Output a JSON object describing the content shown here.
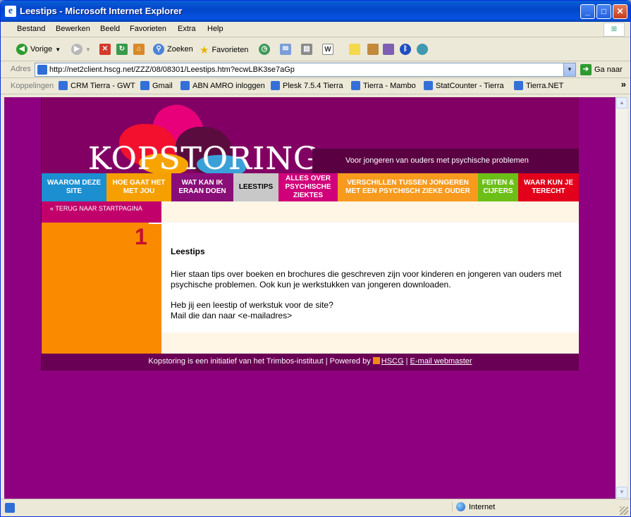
{
  "window": {
    "title": "Leestips - Microsoft Internet Explorer",
    "min": "_",
    "max": "□",
    "close": "✕"
  },
  "menu": [
    "Bestand",
    "Bewerken",
    "Beeld",
    "Favorieten",
    "Extra",
    "Help"
  ],
  "toolbar": {
    "back": "Vorige",
    "search": "Zoeken",
    "favorites": "Favorieten"
  },
  "address": {
    "label": "Adres",
    "url": "http://net2client.hscg.net/ZZZ/08/08301/Leestips.htm?ecwLBK3se7aGp",
    "go": "Ga naar"
  },
  "links": {
    "label": "Koppelingen",
    "items": [
      "CRM Tierra - GWT",
      "Gmail",
      "ABN AMRO inloggen",
      "Plesk 7.5.4 Tierra",
      "Tierra - Mambo",
      "StatCounter - Tierra",
      "Tierra.NET"
    ]
  },
  "site": {
    "logo": "KOPSTORING",
    "tagline": "Voor jongeren van ouders met psychische problemen",
    "nav": [
      {
        "label": "WAAROM DEZE SITE",
        "color": "#1b8fd0"
      },
      {
        "label": "HOE GAAT HET MET JOU",
        "color": "#f5a000"
      },
      {
        "label": "WAT KAN IK ERAAN DOEN",
        "color": "#8a0e78"
      },
      {
        "label": "LEESTIPS",
        "color": "#c8c8c8",
        "text": "#000000"
      },
      {
        "label": "ALLES OVER PSYCHISCHE ZIEKTES",
        "color": "#d0007a"
      },
      {
        "label": "VERSCHILLEN TUSSEN JONGEREN MET EEN PSYCHISCH ZIEKE OUDER",
        "color": "#f79a1e"
      },
      {
        "label": "FEITEN & CIJFERS",
        "color": "#6cbf17"
      },
      {
        "label": "WAAR KUN JE TERECHT",
        "color": "#e2001a"
      }
    ],
    "back_link": "« TERUG NAAR STARTPAGINA",
    "number": "1",
    "heading": "Leestips",
    "paragraph1": "Hier staan tips over boeken en brochures die geschreven zijn voor kinderen en jongeren van ouders met psychische problemen. Ook kun je werkstukken van jongeren downloaden.",
    "paragraph2_line1": "Heb jij een leestip of werkstuk voor de site?",
    "paragraph2_line2": "Mail die dan naar <e-mailadres>",
    "footer_text": "Kopstoring is een initiatief van het Trimbos-instituut | Powered by",
    "footer_hscg": "HSCG",
    "footer_sep": "|",
    "footer_email": "E-mail webmaster"
  },
  "status": {
    "zone": "Internet"
  }
}
